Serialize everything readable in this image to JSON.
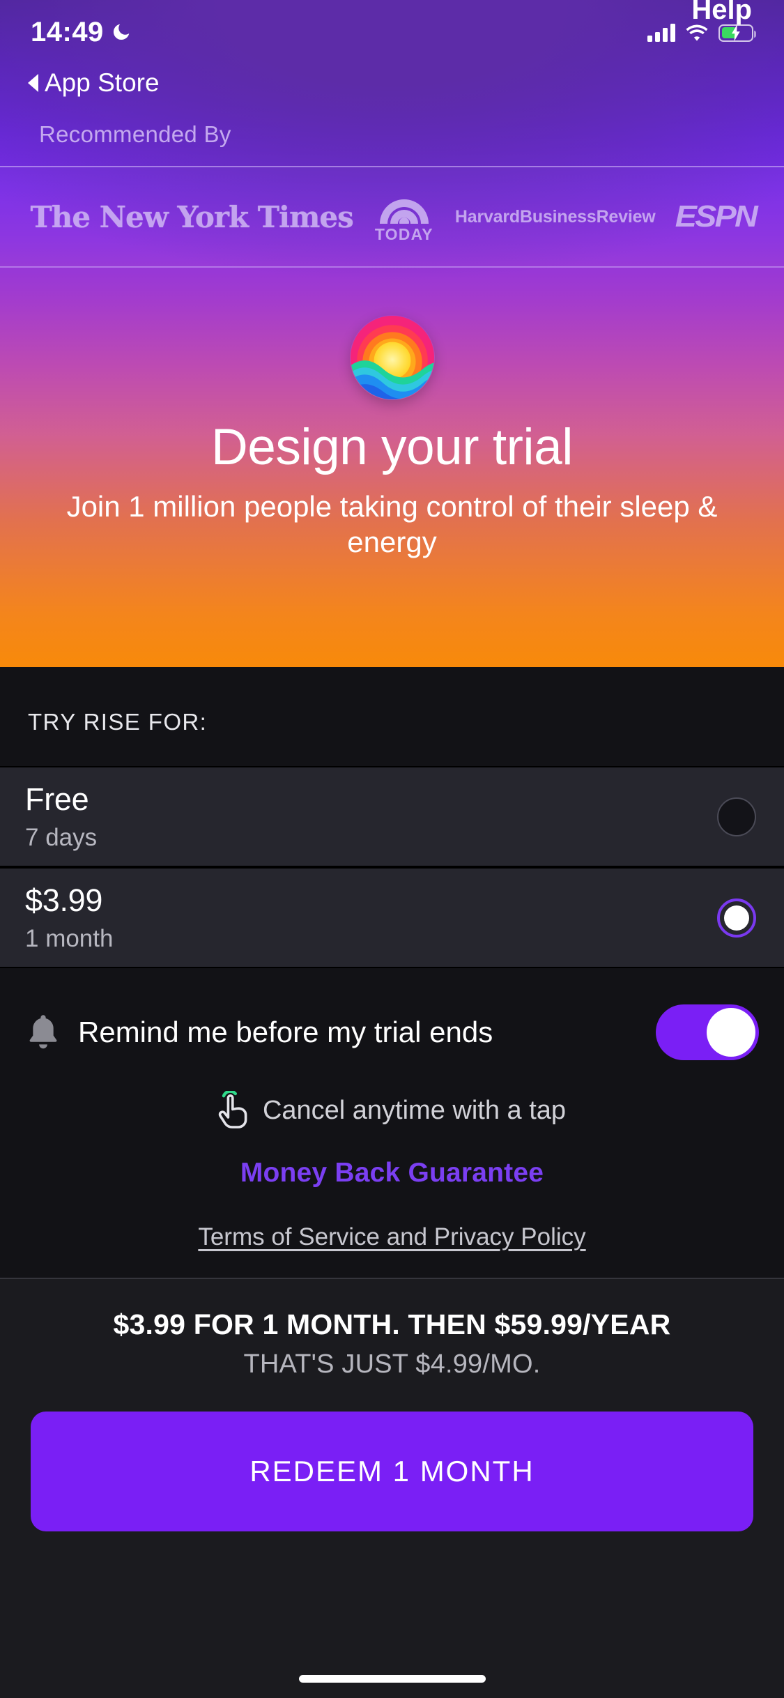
{
  "status_bar": {
    "time": "14:49",
    "moon_icon": "moon-icon",
    "signal_icon": "cellular-signal-icon",
    "wifi_icon": "wifi-icon",
    "battery_icon": "battery-charging-icon"
  },
  "nav": {
    "back_label": "App Store",
    "back_icon": "back-caret-icon",
    "help_label": "Help"
  },
  "recommended": {
    "label": "Recommended By",
    "logos": [
      {
        "name": "nyt-logo",
        "text": "The New York Times"
      },
      {
        "name": "today-logo",
        "text": "TODAY"
      },
      {
        "name": "hbr-logo",
        "line1": "Harvard",
        "line2": "Business",
        "line3": "Review"
      },
      {
        "name": "espn-logo",
        "text": "ESPN"
      }
    ]
  },
  "hero": {
    "app_icon": "rise-sunrise-app-icon",
    "title": "Design your trial",
    "subtitle": "Join 1 million people taking control of their sleep & energy"
  },
  "plans": {
    "label": "TRY RISE FOR:",
    "options": [
      {
        "price": "Free",
        "period": "7 days",
        "selected": false
      },
      {
        "price": "$3.99",
        "period": "1 month",
        "selected": true
      }
    ]
  },
  "reminder": {
    "bell_icon": "bell-icon",
    "label": "Remind me before my trial ends",
    "toggle_on": true
  },
  "assurances": {
    "tap_icon": "tap-hand-icon",
    "cancel_text": "Cancel anytime with a tap",
    "guarantee_text": "Money Back Guarantee",
    "terms_text": "Terms of Service and Privacy Policy"
  },
  "cta": {
    "line1": "$3.99 FOR 1 MONTH. THEN $59.99/YEAR",
    "line2": "THAT'S JUST $4.99/MO.",
    "button_label": "REDEEM 1 MONTH"
  },
  "colors": {
    "accent_purple": "#7a1ff5",
    "guarantee_purple": "#7b3ff2",
    "battery_green": "#3ad960",
    "panel_dark": "#121216",
    "plan_row": "#26262e"
  }
}
